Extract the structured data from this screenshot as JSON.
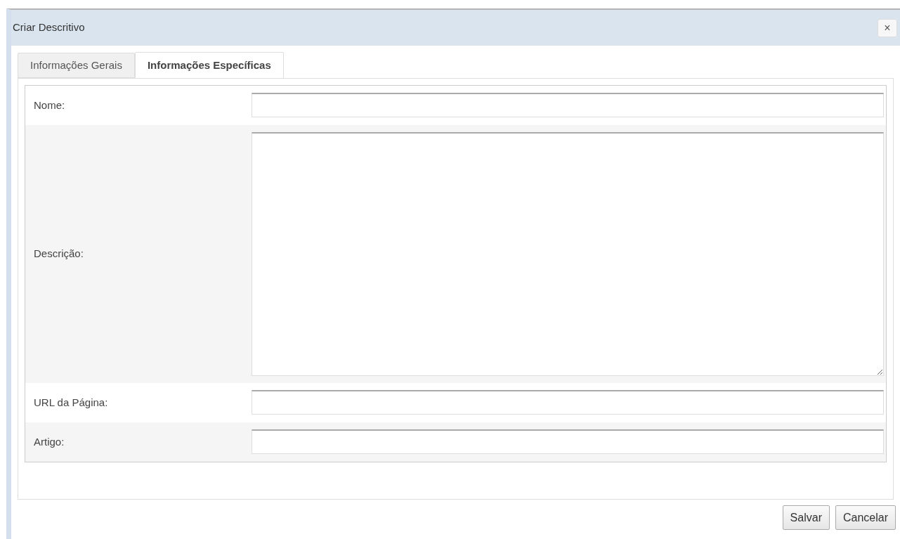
{
  "dialog": {
    "title": "Criar Descritivo",
    "close": "×"
  },
  "tabs": [
    {
      "label": "Informações Gerais",
      "selected": false
    },
    {
      "label": "Informações Específicas",
      "selected": true
    }
  ],
  "fields": [
    {
      "label": "Nome:",
      "kind": "text"
    },
    {
      "label": "Descrição:",
      "kind": "textarea"
    },
    {
      "label": "URL da Página:",
      "kind": "text"
    },
    {
      "label": "Artigo:",
      "kind": "text"
    }
  ],
  "buttons": [
    "Salvar",
    "Cancelar"
  ]
}
